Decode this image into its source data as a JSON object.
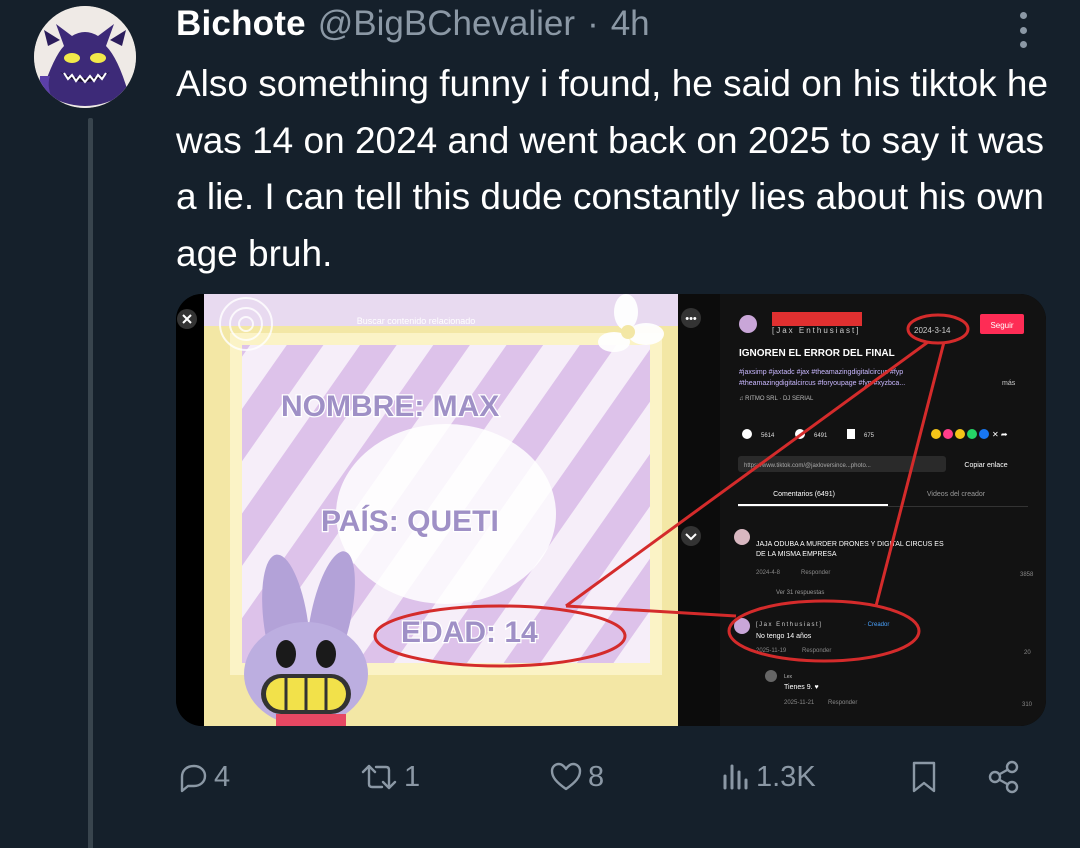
{
  "tweet": {
    "display_name": "Bichote",
    "handle": "@BigBChevalier",
    "separator": "·",
    "timestamp": "4h",
    "text": "Also something funny i found, he said on his tiktok he was 14 on 2024 and went back on 2025 to say it was a lie. I can tell this dude constantly lies about his own age bruh."
  },
  "media": {
    "left_panel": {
      "search_placeholder": "Buscar contenido relacionado",
      "nombre": "NOMBRE: MAX",
      "pais": "PAÍS: QUETI",
      "edad": "EDAD: 14"
    },
    "right_panel": {
      "author": "[Jax Enthusiast]",
      "date": "2024-3-14",
      "follow_button": "Seguir",
      "post_title": "IGNOREN EL ERROR DEL FINAL",
      "hashtags_line1": "#jaxsimp #jaxtadc #jax #theamazingdigitalcircus #fyp",
      "hashtags_line2": "#theamazingdigitalcircus #foryoupage #fyp #xyzbca...",
      "more_link": "más",
      "sound": "♫ RITMO SRL · DJ SERIAL",
      "likes": "5614",
      "comments": "6491",
      "saves": "675",
      "link": "https://www.tiktok.com/@jaxloversince...photo...",
      "copy_link": "Copiar enlace",
      "tab_comments": "Comentarios (6491)",
      "tab_creator_videos": "Videos del creador",
      "comment1_text_line1": "JAJA ODUBA A MURDER DRONES Y DIGITAL CIRCUS ES",
      "comment1_text_line2": "DE LA MISMA EMPRESA",
      "comment1_date": "2024-4-8",
      "comment1_reply": "Responder",
      "comment1_likes": "3858",
      "view_replies": "Ver 31 respuestas",
      "reply_author": "[Jax Enthusiast]",
      "reply_badge": "· Creador",
      "reply_text": "No tengo 14 años",
      "reply_date": "2025-11-19",
      "reply_reply": "Responder",
      "reply_likes": "20",
      "reply2_author": "Lex",
      "reply2_text": "Tienes 9. ♥",
      "reply2_date": "2025-11-21",
      "reply2_reply": "Responder",
      "reply2_likes": "310"
    }
  },
  "actions": {
    "replies": "4",
    "reposts": "1",
    "likes": "8",
    "views": "1.3K"
  },
  "colors": {
    "background": "#15202b",
    "secondary_text": "#8b98a5",
    "annotation_red": "#d42b2b",
    "follow_button": "#fe2c55"
  }
}
